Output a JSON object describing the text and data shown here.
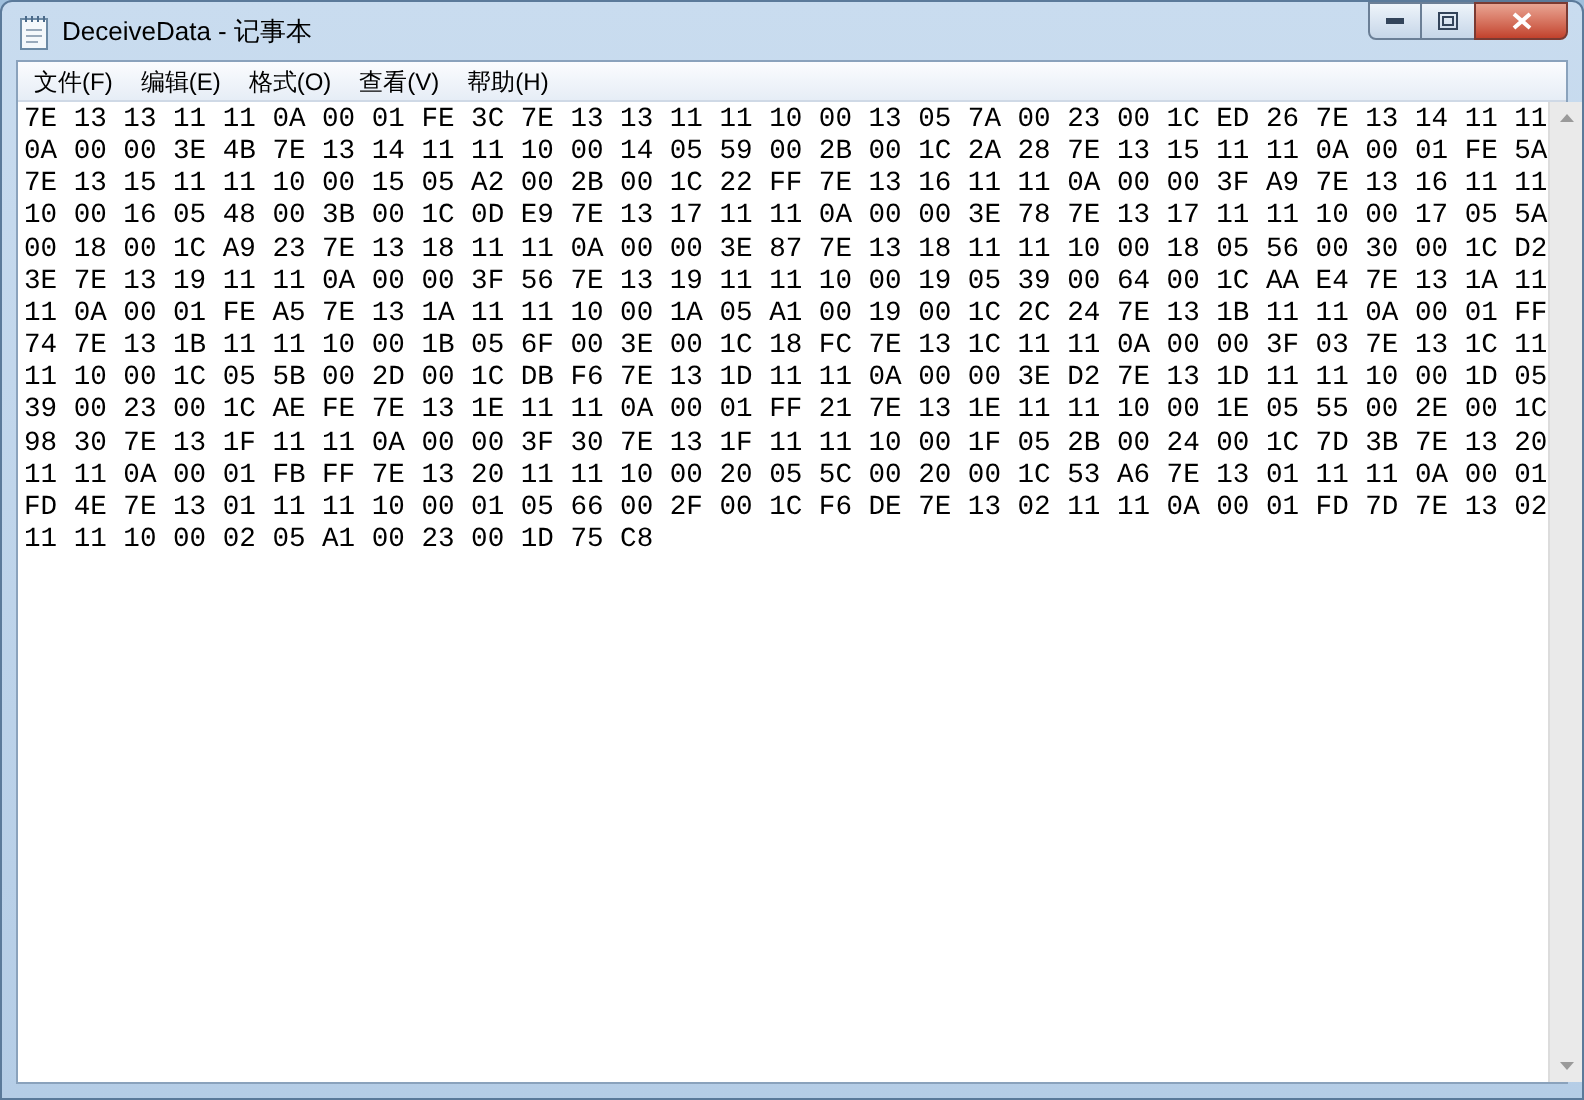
{
  "window": {
    "title": "DeceiveData - 记事本"
  },
  "menu": [
    "文件(F)",
    "编辑(E)",
    "格式(O)",
    "查看(V)",
    "帮助(H)"
  ],
  "editor": {
    "lines": [
      "7E 13 13 11 11 0A 00 01 FE 3C 7E 13 13 11 11 10 00 13 05 7A 00 23 00 1C ED 26 7E 13 14 11 11",
      "0A 00 00 3E 4B 7E 13 14 11 11 10 00 14 05 59 00 2B 00 1C 2A 28 7E 13 15 11 11 0A 00 01 FE 5A",
      "7E 13 15 11 11 10 00 15 05 A2 00 2B 00 1C 22 FF 7E 13 16 11 11 0A 00 00 3F A9 7E 13 16 11 11",
      "10 00 16 05 48 00 3B 00 1C 0D E9 7E 13 17 11 11 0A 00 00 3E 78 7E 13 17 11 11 10 00 17 05 5A",
      "00 18 00 1C A9 23 7E 13 18 11 11 0A 00 00 3E 87 7E 13 18 11 11 10 00 18 05 56 00 30 00 1C D2",
      "3E 7E 13 19 11 11 0A 00 00 3F 56 7E 13 19 11 11 10 00 19 05 39 00 64 00 1C AA E4 7E 13 1A 11",
      "11 0A 00 01 FE A5 7E 13 1A 11 11 10 00 1A 05 A1 00 19 00 1C 2C 24 7E 13 1B 11 11 0A 00 01 FF",
      "74 7E 13 1B 11 11 10 00 1B 05 6F 00 3E 00 1C 18 FC 7E 13 1C 11 11 0A 00 00 3F 03 7E 13 1C 11",
      "11 10 00 1C 05 5B 00 2D 00 1C DB F6 7E 13 1D 11 11 0A 00 00 3E D2 7E 13 1D 11 11 10 00 1D 05",
      "39 00 23 00 1C AE FE 7E 13 1E 11 11 0A 00 01 FF 21 7E 13 1E 11 11 10 00 1E 05 55 00 2E 00 1C",
      "98 30 7E 13 1F 11 11 0A 00 00 3F 30 7E 13 1F 11 11 10 00 1F 05 2B 00 24 00 1C 7D 3B 7E 13 20",
      "11 11 0A 00 01 FB FF 7E 13 20 11 11 10 00 20 05 5C 00 20 00 1C 53 A6 7E 13 01 11 11 0A 00 01",
      "FD 4E 7E 13 01 11 11 10 00 01 05 66 00 2F 00 1C F6 DE 7E 13 02 11 11 0A 00 01 FD 7D 7E 13 02",
      "11 11 10 00 02 05 A1 00 23 00 1D 75 C8"
    ]
  }
}
